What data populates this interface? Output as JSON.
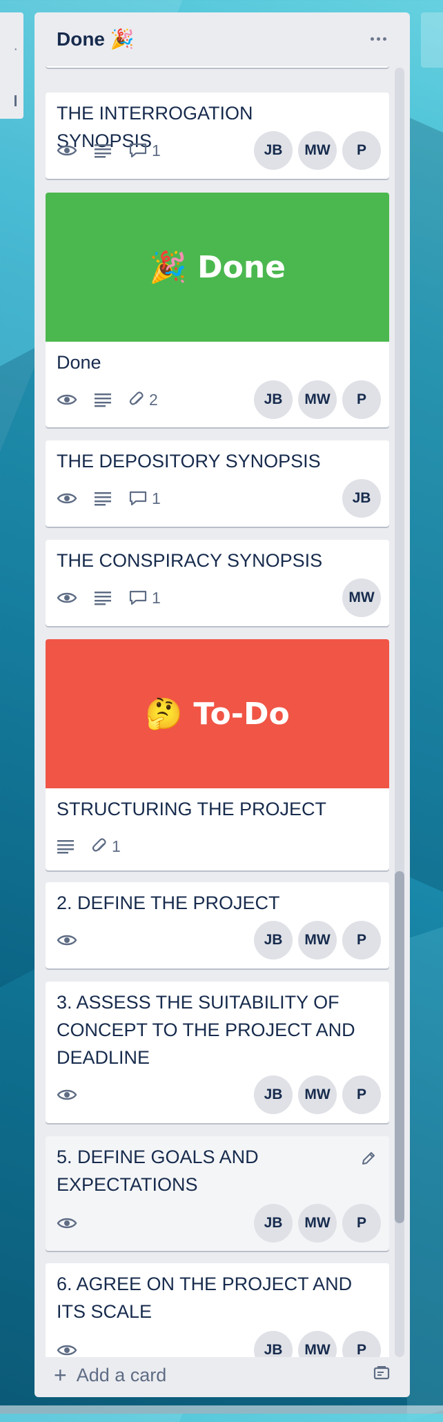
{
  "list": {
    "title": "Done 🎉",
    "menu_icon": "more-horizontal-icon",
    "add_card_label": "Add a card",
    "add_card_icon": "plus-icon",
    "template_icon": "card-template-icon"
  },
  "colors": {
    "green_cover": "#4bb84f",
    "red_cover": "#f05545",
    "list_bg": "#ebecf0",
    "avatar_bg": "#dfe1e6"
  },
  "cards": [
    {
      "title": "THE INTERROGATION SYNOPSIS",
      "badges": {
        "watch": "eye-icon",
        "description": "description-icon",
        "comments": "1"
      },
      "members": [
        "JB",
        "MW",
        "P"
      ]
    },
    {
      "cover_text": "🎉 Done",
      "title": "Done",
      "badges": {
        "watch": "eye-icon",
        "description": "description-icon",
        "attachments": "2"
      },
      "members": [
        "JB",
        "MW",
        "P"
      ]
    },
    {
      "title": "THE DEPOSITORY SYNOPSIS",
      "badges": {
        "watch": "eye-icon",
        "description": "description-icon",
        "comments": "1"
      },
      "members": [
        "JB"
      ]
    },
    {
      "title": "THE CONSPIRACY SYNOPSIS",
      "badges": {
        "watch": "eye-icon",
        "description": "description-icon",
        "comments": "1"
      },
      "members": [
        "MW"
      ]
    },
    {
      "cover_text": "🤔 To-Do",
      "title": "STRUCTURING THE PROJECT",
      "badges": {
        "description": "description-icon",
        "attachments": "1"
      },
      "members": []
    },
    {
      "title": "2. DEFINE THE PROJECT",
      "badges": {
        "watch": "eye-icon"
      },
      "members": [
        "JB",
        "MW",
        "P"
      ]
    },
    {
      "title": "3. ASSESS THE SUITABILITY OF CONCEPT TO THE PROJECT AND DEADLINE",
      "badges": {
        "watch": "eye-icon"
      },
      "members": [
        "JB",
        "MW",
        "P"
      ]
    },
    {
      "title": "5. DEFINE GOALS AND EXPECTATIONS",
      "edit_icon": "pencil-icon",
      "badges": {
        "watch": "eye-icon"
      },
      "members": [
        "JB",
        "MW",
        "P"
      ]
    },
    {
      "title": "6. AGREE ON THE PROJECT AND ITS SCALE",
      "badges": {
        "watch": "eye-icon"
      },
      "members": [
        "JB",
        "MW",
        "P"
      ]
    }
  ]
}
